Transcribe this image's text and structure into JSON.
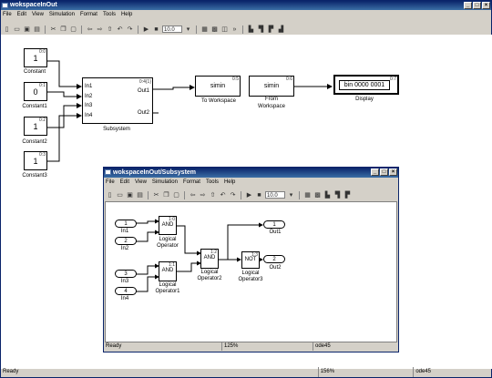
{
  "main_window": {
    "title": "wokspaceInOut",
    "menu": [
      "File",
      "Edit",
      "View",
      "Simulation",
      "Format",
      "Tools",
      "Help"
    ],
    "stop_time": "10.0",
    "status": {
      "ready": "Ready",
      "zoom": "156%",
      "solver": "ode45"
    }
  },
  "main_blocks": {
    "constant": {
      "value": "1",
      "prio": "0:0",
      "label": "Constant"
    },
    "constant1": {
      "value": "0",
      "prio": "0:1",
      "label": "Constant1"
    },
    "constant2": {
      "value": "1",
      "prio": "0:2",
      "label": "Constant2"
    },
    "constant3": {
      "value": "1",
      "prio": "0:3",
      "label": "Constant3"
    },
    "subsystem": {
      "prio": "0:4{1}",
      "label": "Subsystem",
      "inports": [
        "In1",
        "In2",
        "In3",
        "In4"
      ],
      "outports": [
        "Out1",
        "Out2"
      ]
    },
    "to_workspace": {
      "text": "simin",
      "prio": "0:5",
      "label": "To Workspace"
    },
    "from_workspace": {
      "text": "simin",
      "prio": "0:6",
      "label_line1": "From",
      "label_line2": "Workspace"
    },
    "display": {
      "text": "bin 0000 0001",
      "prio": "0:7",
      "label": "Display"
    }
  },
  "sub_window": {
    "title": "wokspaceInOut/Subsystem",
    "menu": [
      "File",
      "Edit",
      "View",
      "Simulation",
      "Format",
      "Tools",
      "Help"
    ],
    "stop_time": "10.0",
    "status": {
      "ready": "Ready",
      "zoom": "125%",
      "solver": "ode45"
    }
  },
  "sub_blocks": {
    "in1": {
      "num": "1",
      "label": "In1"
    },
    "in2": {
      "num": "2",
      "label": "In2"
    },
    "in3": {
      "num": "3",
      "label": "In3"
    },
    "in4": {
      "num": "4",
      "label": "In4"
    },
    "and1": {
      "text": "AND",
      "prio": "1:0",
      "label_line1": "Logical",
      "label_line2": "Operator"
    },
    "and2": {
      "text": "AND",
      "prio": "1:2",
      "label_line1": "Logical",
      "label_line2": "Operator2"
    },
    "and3": {
      "text": "AND",
      "prio": "1:1",
      "label_line1": "Logical",
      "label_line2": "Operator1"
    },
    "not": {
      "text": "NOT",
      "prio": "1:3",
      "label_line1": "Logical",
      "label_line2": "Operator3"
    },
    "out1": {
      "num": "1",
      "label": "Out1"
    },
    "out2": {
      "num": "2",
      "label": "Out2"
    }
  },
  "colors": {
    "title_bar": "#0a246a",
    "chrome": "#d4d0c8",
    "canvas": "#ffffff"
  },
  "icons": [
    "new-icon",
    "open-icon",
    "save-icon",
    "print-icon",
    "cut-icon",
    "copy-icon",
    "paste-icon",
    "undo-icon",
    "redo-icon",
    "play-icon",
    "stop-icon",
    "library-icon",
    "model-explorer-icon",
    "debug-icon"
  ]
}
